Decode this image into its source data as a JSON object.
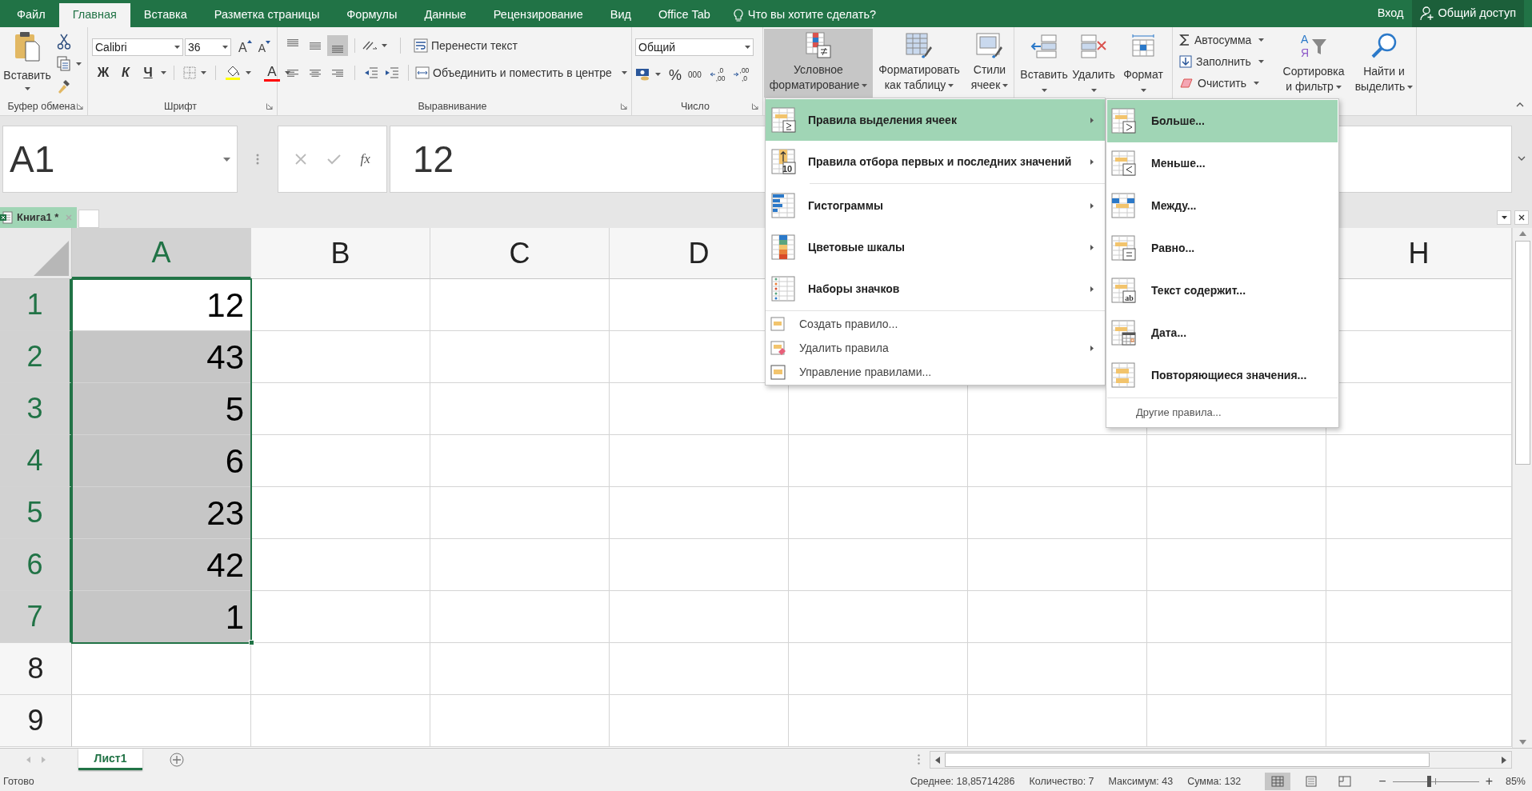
{
  "title_bar": {
    "tabs": [
      {
        "label": "Файл",
        "selected": false
      },
      {
        "label": "Главная",
        "selected": true
      },
      {
        "label": "Вставка",
        "selected": false
      },
      {
        "label": "Разметка страницы",
        "selected": false
      },
      {
        "label": "Формулы",
        "selected": false
      },
      {
        "label": "Данные",
        "selected": false
      },
      {
        "label": "Рецензирование",
        "selected": false
      },
      {
        "label": "Вид",
        "selected": false
      },
      {
        "label": "Office Tab",
        "selected": false
      }
    ],
    "tell_me": "Что вы хотите сделать?",
    "sign_in": "Вход",
    "share": "Общий доступ"
  },
  "ribbon": {
    "clipboard": {
      "paste": "Вставить",
      "label": "Буфер обмена"
    },
    "font": {
      "name": "Calibri",
      "size": "36",
      "grow": "A",
      "shrink": "A",
      "bold": "Ж",
      "italic": "К",
      "underline": "Ч",
      "color_letter": "A",
      "label": "Шрифт"
    },
    "alignment": {
      "vertical": [
        {
          "selected": false
        },
        {
          "selected": false
        },
        {
          "selected": true
        }
      ],
      "wrap_text": "Перенести текст",
      "merge": "Объединить и поместить в центре",
      "label": "Выравнивание"
    },
    "number": {
      "format": "Общий",
      "percent": "%",
      "thousands": "000",
      "decimals": [
        {
          "top": ",0",
          "bottom": ",00"
        },
        {
          "top": ",00",
          "bottom": ",0"
        }
      ],
      "label": "Число"
    },
    "styles": [
      {
        "lines": [
          "Условное",
          "форматирование"
        ],
        "pressed": true
      },
      {
        "lines": [
          "Форматировать",
          "как таблицу"
        ],
        "pressed": false
      },
      {
        "lines": [
          "Стили",
          "ячеек"
        ],
        "pressed": false
      }
    ],
    "cells": [
      {
        "label": "Вставить"
      },
      {
        "label": "Удалить"
      },
      {
        "label": "Формат"
      }
    ],
    "editing": {
      "small": [
        "Автосумма",
        "Заполнить",
        "Очистить"
      ],
      "sort_letters": [
        "А",
        "Я"
      ],
      "large": [
        {
          "lines": [
            "Сортировка",
            "и фильтр"
          ]
        },
        {
          "lines": [
            "Найти и",
            "выделить"
          ]
        }
      ]
    }
  },
  "formula_bar": {
    "name_box": "A1",
    "fx": "fx",
    "value": "12"
  },
  "workbook_tabs": [
    {
      "label": "Книга1 *",
      "selected": true
    }
  ],
  "sheet": {
    "columns": [
      {
        "label": "A",
        "selected": true
      },
      {
        "label": "B",
        "selected": false
      },
      {
        "label": "C",
        "selected": false
      },
      {
        "label": "D",
        "selected": false
      },
      {
        "label": "H",
        "selected": false
      }
    ],
    "rows": [
      {
        "header": "1",
        "selected": true,
        "active": true,
        "value": "12"
      },
      {
        "header": "2",
        "selected": true,
        "active": false,
        "value": "43"
      },
      {
        "header": "3",
        "selected": true,
        "active": false,
        "value": "5"
      },
      {
        "header": "4",
        "selected": true,
        "active": false,
        "value": "6"
      },
      {
        "header": "5",
        "selected": true,
        "active": false,
        "value": "23"
      },
      {
        "header": "6",
        "selected": true,
        "active": false,
        "value": "42"
      },
      {
        "header": "7",
        "selected": true,
        "active": false,
        "value": "1"
      },
      {
        "header": "8",
        "selected": false,
        "active": false
      },
      {
        "header": "9",
        "selected": false,
        "active": false
      }
    ]
  },
  "menu": {
    "items": [
      {
        "kind": "large",
        "label": "Правила выделения ячеек",
        "submenu": true,
        "selected": true,
        "divider_above": false
      },
      {
        "kind": "large",
        "label": "Правила отбора первых и последних значений",
        "submenu": true,
        "selected": false,
        "divider_above": false,
        "icon_text": "10"
      },
      {
        "kind": "large",
        "label": "Гистограммы",
        "submenu": true,
        "selected": false,
        "divider_above": true
      },
      {
        "kind": "large",
        "label": "Цветовые шкалы",
        "submenu": true,
        "selected": false,
        "divider_above": false
      },
      {
        "kind": "large",
        "label": "Наборы значков",
        "submenu": true,
        "selected": false,
        "divider_above": false
      },
      {
        "kind": "small",
        "label": "Создать правило...",
        "submenu": false,
        "selected": false,
        "divider_above": true
      },
      {
        "kind": "small",
        "label": "Удалить правила",
        "submenu": true,
        "selected": false,
        "divider_above": false
      },
      {
        "kind": "small",
        "label": "Управление правилами...",
        "submenu": false,
        "selected": false,
        "divider_above": false
      }
    ]
  },
  "submenu": {
    "items": [
      {
        "kind": "large",
        "label": "Больше...",
        "selected": true
      },
      {
        "kind": "large",
        "label": "Меньше...",
        "selected": false
      },
      {
        "kind": "large",
        "label": "Между...",
        "selected": false
      },
      {
        "kind": "large",
        "label": "Равно...",
        "selected": false
      },
      {
        "kind": "large",
        "label": "Текст содержит...",
        "selected": false,
        "icon_text": "ab"
      },
      {
        "kind": "large",
        "label": "Дата...",
        "selected": false
      },
      {
        "kind": "large",
        "label": "Повторяющиеся значения...",
        "selected": false
      },
      {
        "kind": "link",
        "label": "Другие правила...",
        "selected": false
      }
    ]
  },
  "sheet_tabs": [
    {
      "label": "Лист1",
      "selected": true
    }
  ],
  "status_bar": {
    "ready": "Готово",
    "stats": [
      "Среднее: 18,85714286",
      "Количество: 7",
      "Максимум: 43",
      "Сумма: 132"
    ],
    "views": [
      {
        "selected": true
      },
      {
        "selected": false
      },
      {
        "selected": false
      }
    ],
    "zoom": {
      "minus": "−",
      "plus": "+",
      "level": 0.42,
      "reading": "85%"
    }
  }
}
